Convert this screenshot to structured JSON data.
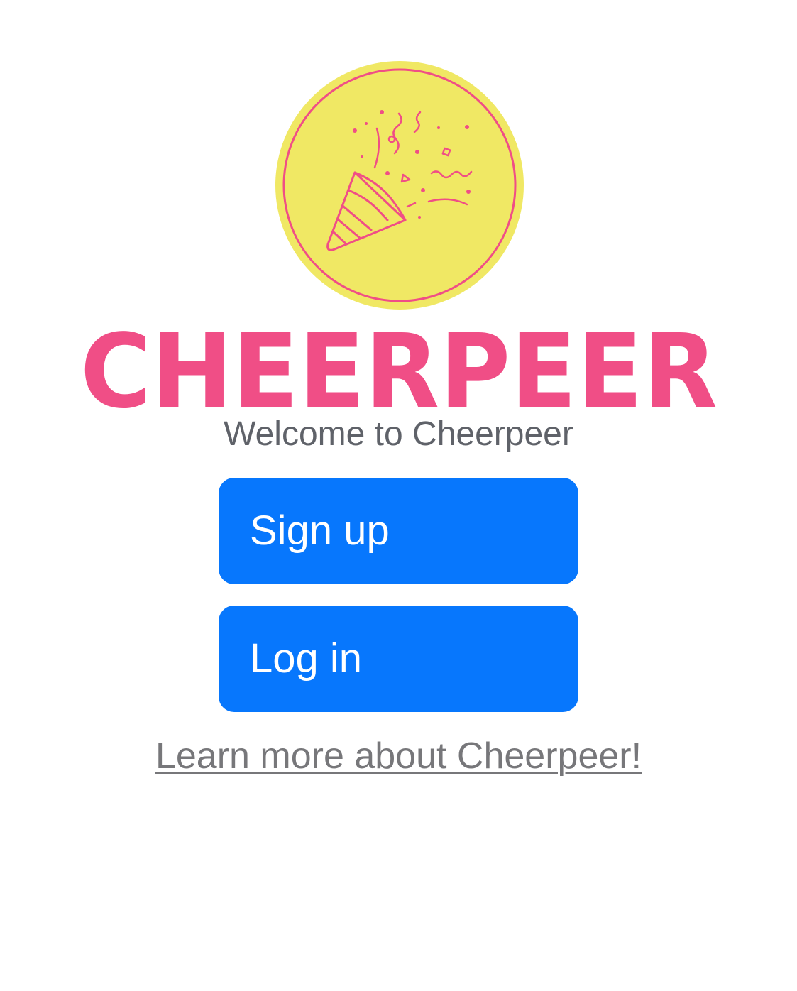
{
  "brand": {
    "wordmark": "CHEERPEER",
    "logo_icon": "party-popper-icon",
    "colors": {
      "pink": "#f04e86",
      "yellow": "#f0e864",
      "white": "#ffffff"
    }
  },
  "welcome_text": "Welcome to Cheerpeer",
  "buttons": {
    "sign_up": "Sign up",
    "log_in": "Log in",
    "color": "#0777fd"
  },
  "learn_more_link": "Learn more about Cheerpeer!"
}
